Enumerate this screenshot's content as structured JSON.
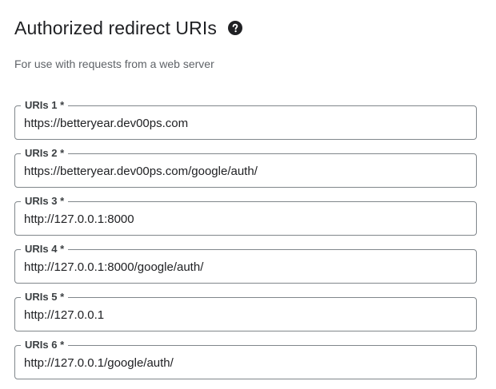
{
  "section": {
    "title": "Authorized redirect URIs",
    "subtitle": "For use with requests from a web server",
    "help_icon": "help-circle-icon"
  },
  "fields": [
    {
      "label": "URIs 1 *",
      "value": "https://betteryear.dev00ps.com"
    },
    {
      "label": "URIs 2 *",
      "value": "https://betteryear.dev00ps.com/google/auth/"
    },
    {
      "label": "URIs 3 *",
      "value": "http://127.0.0.1:8000"
    },
    {
      "label": "URIs 4 *",
      "value": "http://127.0.0.1:8000/google/auth/"
    },
    {
      "label": "URIs 5 *",
      "value": "http://127.0.0.1"
    },
    {
      "label": "URIs 6 *",
      "value": "http://127.0.0.1/google/auth/"
    }
  ],
  "colors": {
    "text_primary": "#202124",
    "text_secondary": "#5f6368",
    "border": "#80868b",
    "background": "#ffffff"
  }
}
